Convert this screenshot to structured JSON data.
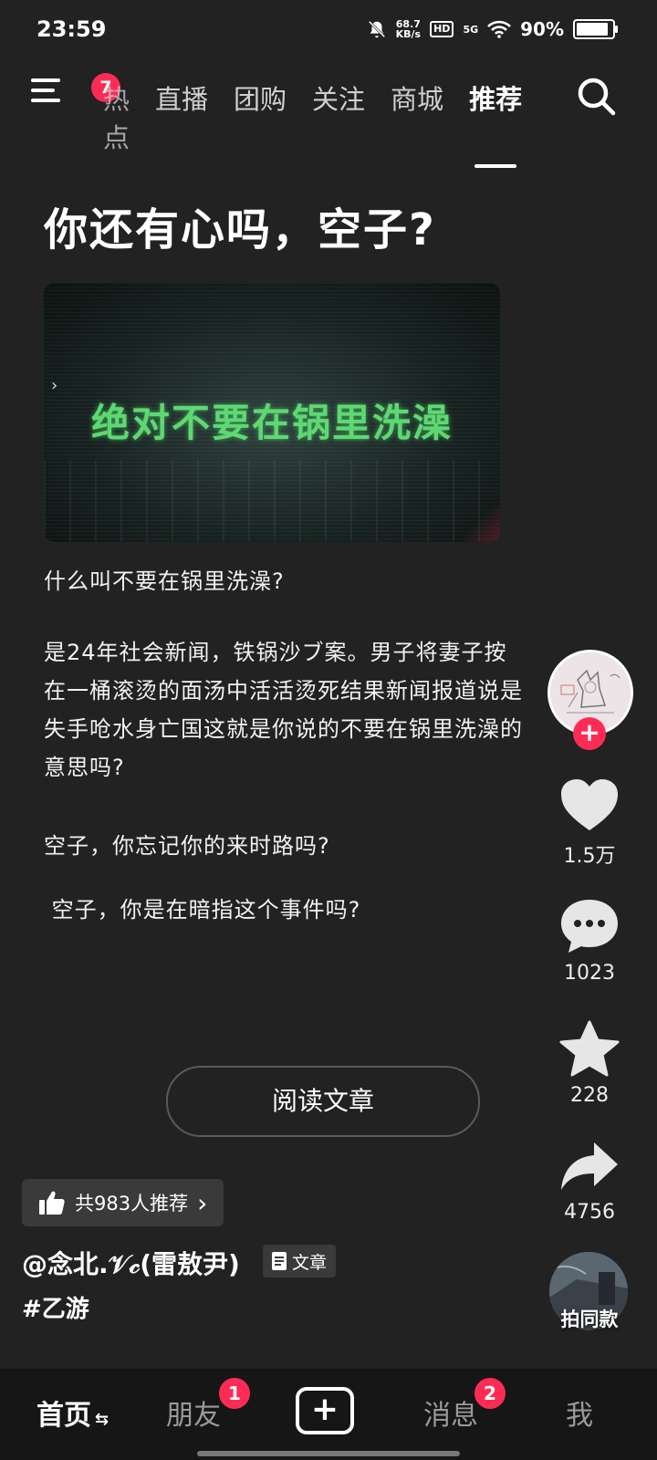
{
  "status_bar": {
    "time": "23:59",
    "net_speed_value": "68.7",
    "net_speed_unit": "KB/s",
    "hd": "HD",
    "network": "5G",
    "battery": "90%",
    "battery_level": 0.9
  },
  "top_nav": {
    "menu_badge": "7",
    "tabs": [
      {
        "label": "热点"
      },
      {
        "label": "直播"
      },
      {
        "label": "团购"
      },
      {
        "label": "关注"
      },
      {
        "label": "商城"
      },
      {
        "label": "推荐"
      }
    ],
    "active_tab": "推荐"
  },
  "article": {
    "title": "你还有心吗，空子?",
    "cover_text": "绝对不要在锅里洗澡",
    "cover_arrow": "›",
    "paragraphs": [
      "什么叫不要在锅里洗澡?",
      "是24年社会新闻，铁锅沙ブ案。男子将妻子按在一桶滚烫的面汤中活活烫死结果新闻报道说是失手呛水身亡国这就是你说的不要在锅里洗澡的意思吗?",
      "空子，你忘记你的来时路吗?",
      " 空子，你是在暗指这个事件吗?"
    ],
    "read_button": "阅读文章",
    "recommend": "共983人推荐",
    "recommend_chevron": "›",
    "author": "@念北.𝒱𝒸(雷敖尹)",
    "type_tag": "文章",
    "hashtag": "#乙游"
  },
  "right_rail": {
    "follow_symbol": "+",
    "likes": "1.5万",
    "comments": "1023",
    "favorites": "228",
    "shares": "4756",
    "same_style": "拍同款"
  },
  "bottom_nav": {
    "home": "首页",
    "home_swap": "⇆",
    "friends": "朋友",
    "friends_badge": "1",
    "create": "+",
    "messages": "消息",
    "messages_badge": "2",
    "me": "我"
  },
  "colors": {
    "background": "#222222",
    "accent": "#fe2c55",
    "cover_text": "#5fd873"
  }
}
